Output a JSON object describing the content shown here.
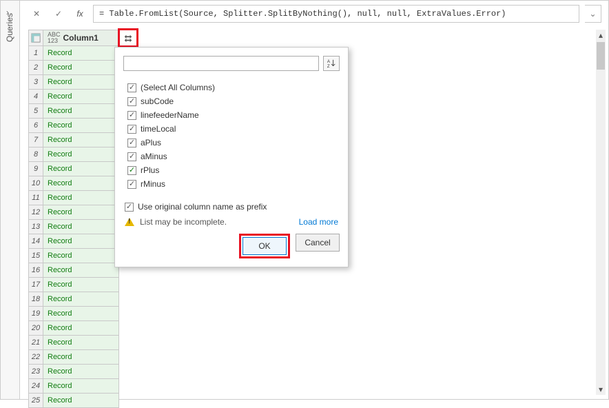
{
  "queries_label": "Queries",
  "fx_label": "fx",
  "formula": "= Table.FromList(Source, Splitter.SplitByNothing(), null, null, ExtraValues.Error)",
  "column": {
    "type_label": "ABC\n123",
    "name": "Column1"
  },
  "rows": [
    {
      "n": "1",
      "v": "Record"
    },
    {
      "n": "2",
      "v": "Record"
    },
    {
      "n": "3",
      "v": "Record"
    },
    {
      "n": "4",
      "v": "Record"
    },
    {
      "n": "5",
      "v": "Record"
    },
    {
      "n": "6",
      "v": "Record"
    },
    {
      "n": "7",
      "v": "Record"
    },
    {
      "n": "8",
      "v": "Record"
    },
    {
      "n": "9",
      "v": "Record"
    },
    {
      "n": "10",
      "v": "Record"
    },
    {
      "n": "11",
      "v": "Record"
    },
    {
      "n": "12",
      "v": "Record"
    },
    {
      "n": "13",
      "v": "Record"
    },
    {
      "n": "14",
      "v": "Record"
    },
    {
      "n": "15",
      "v": "Record"
    },
    {
      "n": "16",
      "v": "Record"
    },
    {
      "n": "17",
      "v": "Record"
    },
    {
      "n": "18",
      "v": "Record"
    },
    {
      "n": "19",
      "v": "Record"
    },
    {
      "n": "20",
      "v": "Record"
    },
    {
      "n": "21",
      "v": "Record"
    },
    {
      "n": "22",
      "v": "Record"
    },
    {
      "n": "23",
      "v": "Record"
    },
    {
      "n": "24",
      "v": "Record"
    },
    {
      "n": "25",
      "v": "Record"
    }
  ],
  "popup": {
    "search_placeholder": "",
    "columns": [
      {
        "label": "(Select All Columns)",
        "checked": true,
        "green": false
      },
      {
        "label": "subCode",
        "checked": true,
        "green": false
      },
      {
        "label": "linefeederName",
        "checked": true,
        "green": false
      },
      {
        "label": "timeLocal",
        "checked": true,
        "green": false
      },
      {
        "label": "aPlus",
        "checked": true,
        "green": false
      },
      {
        "label": "aMinus",
        "checked": true,
        "green": false
      },
      {
        "label": "rPlus",
        "checked": true,
        "green": true
      },
      {
        "label": "rMinus",
        "checked": true,
        "green": false
      }
    ],
    "prefix_label": "Use original column name as prefix",
    "prefix_checked": true,
    "warning_text": "List may be incomplete.",
    "load_more": "Load more",
    "ok_label": "OK",
    "cancel_label": "Cancel"
  }
}
